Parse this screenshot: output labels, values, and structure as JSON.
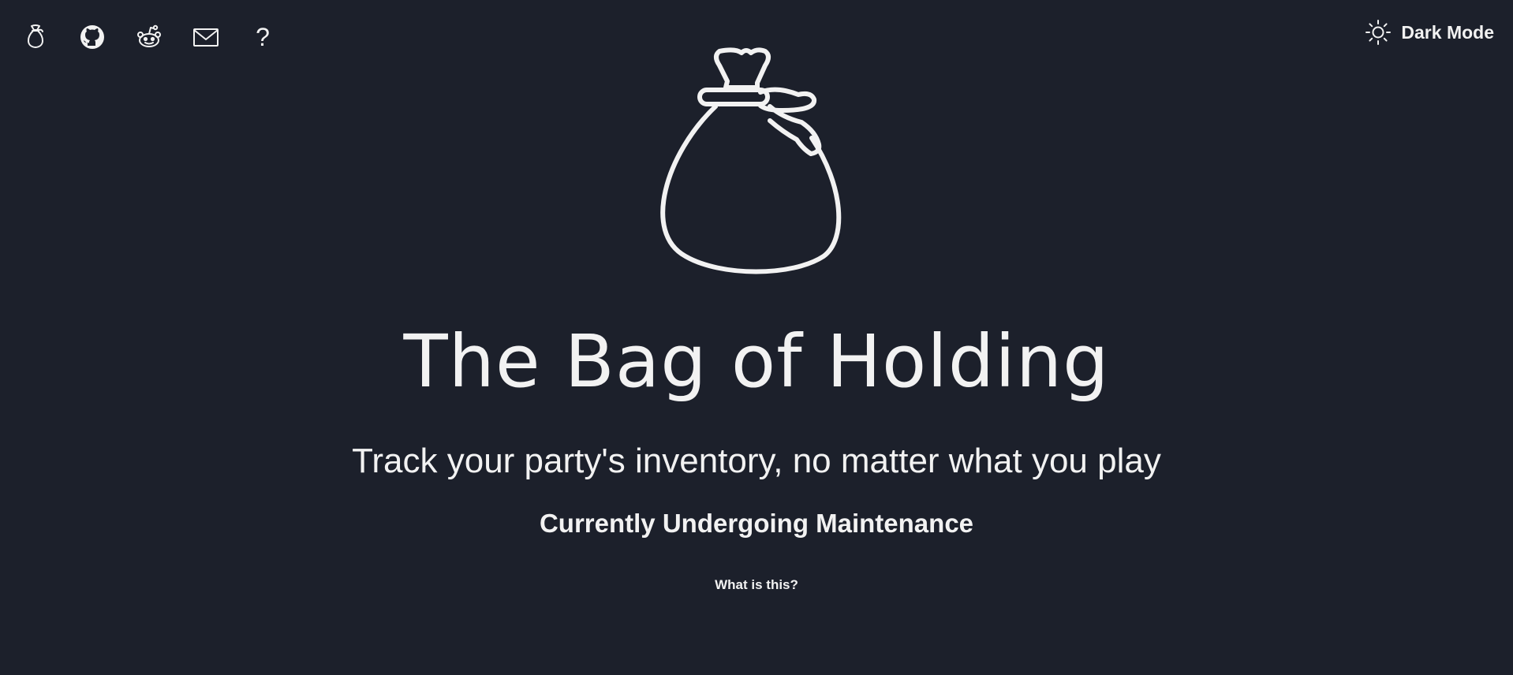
{
  "nav": {
    "items": [
      {
        "icon": "bag-icon"
      },
      {
        "icon": "github-icon"
      },
      {
        "icon": "reddit-icon"
      },
      {
        "icon": "mail-icon"
      },
      {
        "icon": "help-icon",
        "glyph": "?"
      }
    ]
  },
  "theme": {
    "label": "Dark Mode",
    "icon": "sun-icon"
  },
  "hero": {
    "logo_icon": "bag-of-holding-icon",
    "title": "The Bag of Holding",
    "tagline": "Track your party's inventory, no matter what you play",
    "status": "Currently Undergoing Maintenance",
    "link": "What is this?"
  },
  "colors": {
    "background": "#1c202b",
    "foreground": "#f2f2f2"
  }
}
